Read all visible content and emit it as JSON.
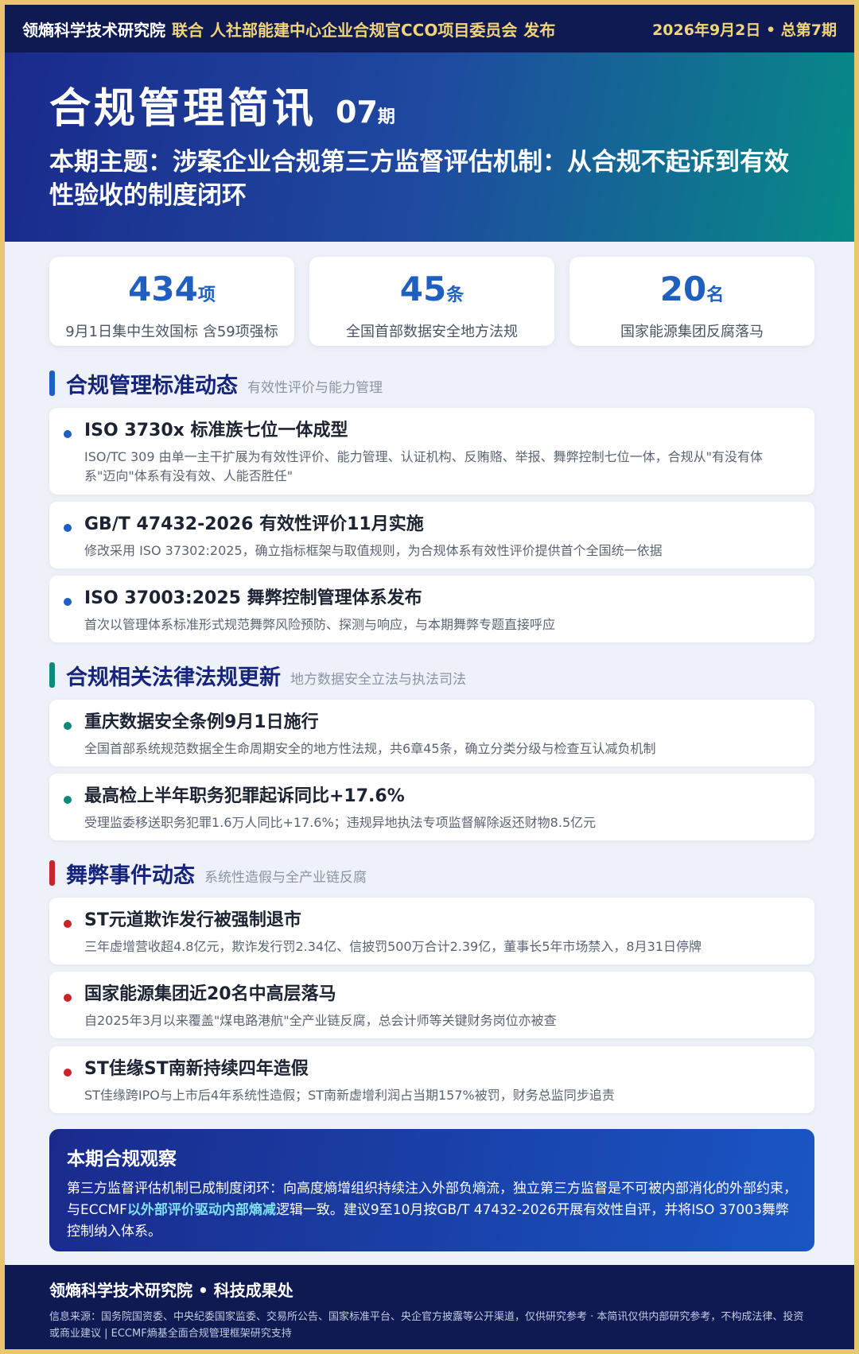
{
  "topbar": {
    "org": "领熵科学技术研究院",
    "connector": "联合",
    "partner": "人社部能建中心企业合规官CCO项目委员会",
    "publish": "发布",
    "date_issue": "2026年9月2日 • 总第7期"
  },
  "hero": {
    "title": "合规管理简讯",
    "issue_num": "07",
    "issue_unit": "期",
    "theme": "本期主题：涉案企业合规第三方监督评估机制：从合规不起诉到有效性验收的制度闭环"
  },
  "stats": [
    {
      "num": "434",
      "unit": "项",
      "desc": "9月1日集中生效国标 含59项强标"
    },
    {
      "num": "45",
      "unit": "条",
      "desc": "全国首部数据安全地方法规"
    },
    {
      "num": "20",
      "unit": "名",
      "desc": "国家能源集团反腐落马"
    }
  ],
  "sections": [
    {
      "title": "合规管理标准动态",
      "subtitle": "有效性评价与能力管理",
      "color": "#1f5fbf",
      "items": [
        {
          "title": "ISO 3730x 标准族七位一体成型",
          "desc": "ISO/TC 309 由单一主干扩展为有效性评价、能力管理、认证机构、反贿赂、举报、舞弊控制七位一体，合规从\"有没有体系\"迈向\"体系有没有效、人能否胜任\""
        },
        {
          "title": "GB/T 47432-2026 有效性评价11月实施",
          "desc": "修改采用 ISO 37302:2025，确立指标框架与取值规则，为合规体系有效性评价提供首个全国统一依据"
        },
        {
          "title": "ISO 37003:2025 舞弊控制管理体系发布",
          "desc": "首次以管理体系标准形式规范舞弊风险预防、探测与响应，与本期舞弊专题直接呼应"
        }
      ]
    },
    {
      "title": "合规相关法律法规更新",
      "subtitle": "地方数据安全立法与执法司法",
      "color": "#0f8a7a",
      "items": [
        {
          "title": "重庆数据安全条例9月1日施行",
          "desc": "全国首部系统规范数据全生命周期安全的地方性法规，共6章45条，确立分类分级与检查互认减负机制"
        },
        {
          "title": "最高检上半年职务犯罪起诉同比+17.6%",
          "desc": "受理监委移送职务犯罪1.6万人同比+17.6%；违规异地执法专项监督解除返还财物8.5亿元"
        }
      ]
    },
    {
      "title": "舞弊事件动态",
      "subtitle": "系统性造假与全产业链反腐",
      "color": "#c8242b",
      "items": [
        {
          "title": "ST元道欺诈发行被强制退市",
          "desc": "三年虚增营收超4.8亿元，欺诈发行罚2.34亿、信披罚500万合计2.39亿，董事长5年市场禁入，8月31日停牌"
        },
        {
          "title": "国家能源集团近20名中高层落马",
          "desc": "自2025年3月以来覆盖\"煤电路港航\"全产业链反腐，总会计师等关键财务岗位亦被查"
        },
        {
          "title": "ST佳缘ST南新持续四年造假",
          "desc": "ST佳缘跨IPO与上市后4年系统性造假；ST南新虚增利润占当期157%被罚，财务总监同步追责"
        }
      ]
    }
  ],
  "observation": {
    "title": "本期合规观察",
    "text_before": "第三方监督评估机制已成制度闭环：向高度熵增组织持续注入外部负熵流，独立第三方监督是不可被内部消化的外部约束，与ECCMF",
    "highlight": "以外部评价驱动内部熵减",
    "text_after": "逻辑一致。建议9至10月按GB/T 47432-2026开展有效性自评，并将ISO 37003舞弊控制纳入体系。"
  },
  "footer": {
    "title": "领熵科学技术研究院 • 科技成果处",
    "source": "信息来源：国务院国资委、中央纪委国家监委、交易所公告、国家标准平台、央企官方披露等公开渠道，仅供研究参考 · 本简讯仅供内部研究参考，不构成法律、投资或商业建议 | ECCMF熵基全面合规管理框架研究支持"
  }
}
